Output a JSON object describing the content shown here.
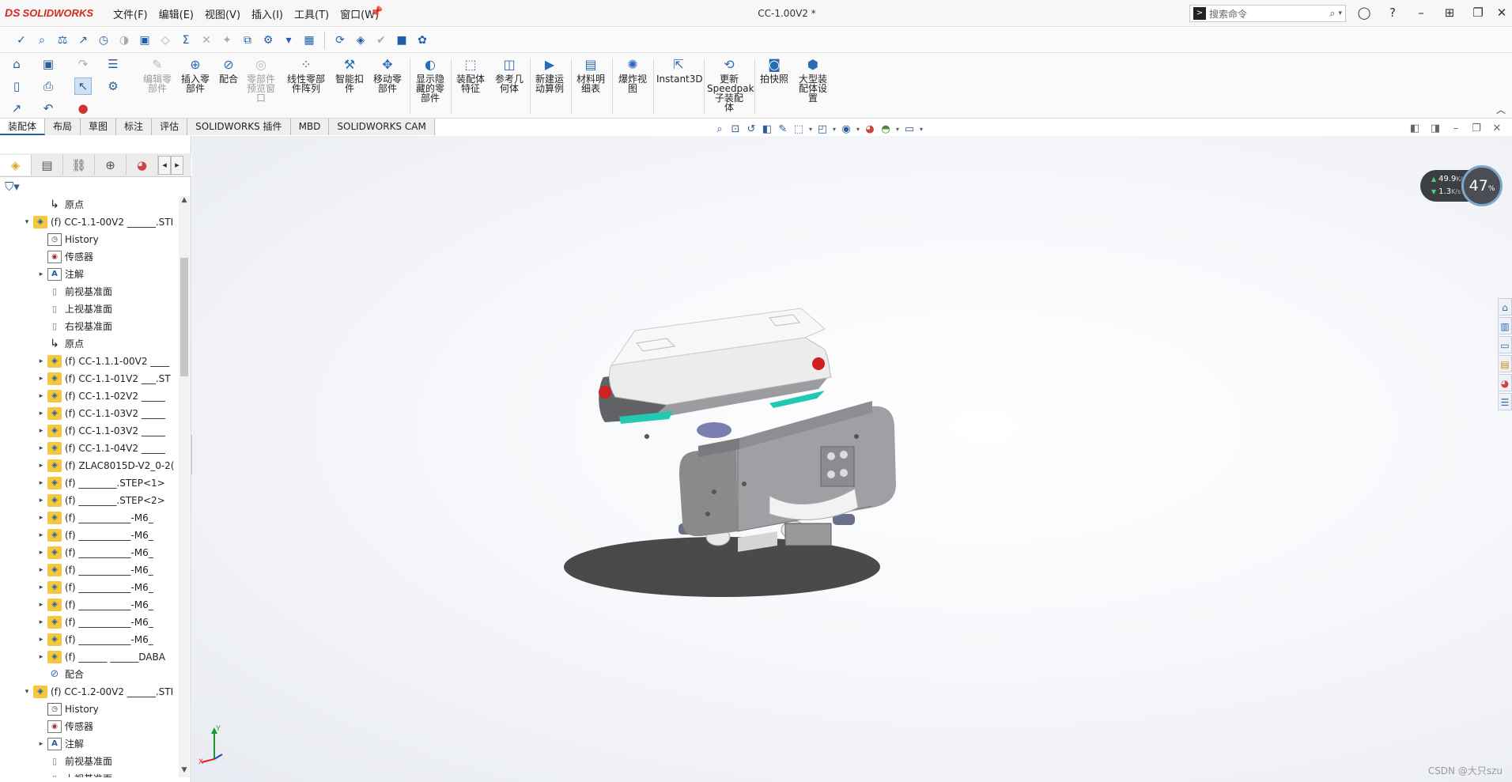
{
  "app": {
    "brand": "SOLIDWORKS",
    "brand_mark": "DS",
    "doc_title": "CC-1.00V2 *"
  },
  "menu": [
    "文件(F)",
    "编辑(E)",
    "视图(V)",
    "插入(I)",
    "工具(T)",
    "窗口(W)"
  ],
  "search": {
    "placeholder": "搜索命令"
  },
  "command_manager": [
    {
      "label": "编辑零\n部件",
      "enabled": false
    },
    {
      "label": "插入零\n部件",
      "enabled": true
    },
    {
      "label": "配合",
      "enabled": true
    },
    {
      "label": "零部件\n预览窗\n口",
      "enabled": false
    },
    {
      "label": "线性零部\n件阵列",
      "enabled": true
    },
    {
      "label": "智能扣\n件",
      "enabled": true
    },
    {
      "label": "移动零\n部件",
      "enabled": true
    },
    {
      "label": "显示隐\n藏的零\n部件",
      "enabled": true
    },
    {
      "label": "装配体\n特征",
      "enabled": true
    },
    {
      "label": "参考几\n何体",
      "enabled": true
    },
    {
      "label": "新建运\n动算例",
      "enabled": true
    },
    {
      "label": "材料明\n细表",
      "enabled": true
    },
    {
      "label": "爆炸视\n图",
      "enabled": true
    },
    {
      "label": "Instant3D",
      "enabled": true
    },
    {
      "label": "更新\nSpeedpak\n子装配\n体",
      "enabled": true
    },
    {
      "label": "拍快照",
      "enabled": true
    },
    {
      "label": "大型装\n配体设\n置",
      "enabled": true
    }
  ],
  "tabs": [
    "装配体",
    "布局",
    "草图",
    "标注",
    "评估",
    "SOLIDWORKS 插件",
    "MBD",
    "SOLIDWORKS CAM"
  ],
  "active_tab": "装配体",
  "tree": [
    {
      "level": 1,
      "expander": "",
      "icon": "origin",
      "label": "原点"
    },
    {
      "level": 0,
      "expander": "down",
      "icon": "asm",
      "label": "(f) CC-1.1-00V2 ______.STI"
    },
    {
      "level": 1,
      "expander": "",
      "icon": "hist",
      "label": "History"
    },
    {
      "level": 1,
      "expander": "",
      "icon": "sens",
      "label": "传感器"
    },
    {
      "level": 1,
      "expander": "right",
      "icon": "ann",
      "label": "注解"
    },
    {
      "level": 1,
      "expander": "",
      "icon": "plane",
      "label": "前视基准面"
    },
    {
      "level": 1,
      "expander": "",
      "icon": "plane",
      "label": "上视基准面"
    },
    {
      "level": 1,
      "expander": "",
      "icon": "plane",
      "label": "右视基准面"
    },
    {
      "level": 1,
      "expander": "",
      "icon": "origin",
      "label": "原点"
    },
    {
      "level": 1,
      "expander": "right",
      "icon": "asm",
      "label": "(f) CC-1.1.1-00V2 ____"
    },
    {
      "level": 1,
      "expander": "right",
      "icon": "asm",
      "label": "(f) CC-1.1-01V2 ___.ST"
    },
    {
      "level": 1,
      "expander": "right",
      "icon": "asm",
      "label": "(f) CC-1.1-02V2 _____"
    },
    {
      "level": 1,
      "expander": "right",
      "icon": "asm",
      "label": "(f) CC-1.1-03V2 _____"
    },
    {
      "level": 1,
      "expander": "right",
      "icon": "asm",
      "label": "(f) CC-1.1-03V2 _____"
    },
    {
      "level": 1,
      "expander": "right",
      "icon": "asm",
      "label": "(f) CC-1.1-04V2 _____"
    },
    {
      "level": 1,
      "expander": "right",
      "icon": "asm",
      "label": "(f) ZLAC8015D-V2_0-2("
    },
    {
      "level": 1,
      "expander": "right",
      "icon": "asm",
      "label": "(f) ________.STEP<1>"
    },
    {
      "level": 1,
      "expander": "right",
      "icon": "asm",
      "label": "(f) ________.STEP<2>"
    },
    {
      "level": 1,
      "expander": "right",
      "icon": "asm",
      "label": "(f) ___________-M6_"
    },
    {
      "level": 1,
      "expander": "right",
      "icon": "asm",
      "label": "(f) ___________-M6_"
    },
    {
      "level": 1,
      "expander": "right",
      "icon": "asm",
      "label": "(f) ___________-M6_"
    },
    {
      "level": 1,
      "expander": "right",
      "icon": "asm",
      "label": "(f) ___________-M6_"
    },
    {
      "level": 1,
      "expander": "right",
      "icon": "asm",
      "label": "(f) ___________-M6_"
    },
    {
      "level": 1,
      "expander": "right",
      "icon": "asm",
      "label": "(f) ___________-M6_"
    },
    {
      "level": 1,
      "expander": "right",
      "icon": "asm",
      "label": "(f) ___________-M6_"
    },
    {
      "level": 1,
      "expander": "right",
      "icon": "asm",
      "label": "(f) ___________-M6_"
    },
    {
      "level": 1,
      "expander": "right",
      "icon": "asm",
      "label": "(f) ______ ______DABA"
    },
    {
      "level": 1,
      "expander": "",
      "icon": "mate",
      "label": "配合"
    },
    {
      "level": 0,
      "expander": "down",
      "icon": "asm",
      "label": "(f) CC-1.2-00V2 ______.STI"
    },
    {
      "level": 1,
      "expander": "",
      "icon": "hist",
      "label": "History"
    },
    {
      "level": 1,
      "expander": "",
      "icon": "sens",
      "label": "传感器"
    },
    {
      "level": 1,
      "expander": "right",
      "icon": "ann",
      "label": "注解"
    },
    {
      "level": 1,
      "expander": "",
      "icon": "plane",
      "label": "前视基准面"
    },
    {
      "level": 1,
      "expander": "",
      "icon": "plane",
      "label": "上视基准面"
    }
  ],
  "net_monitor": {
    "upload": "49.9",
    "download": "1.3",
    "unit": "K/s",
    "percent": "47",
    "percent_sign": "%"
  },
  "triad": {
    "y": "Y",
    "x": "X"
  },
  "watermark": "CSDN @大只szu"
}
